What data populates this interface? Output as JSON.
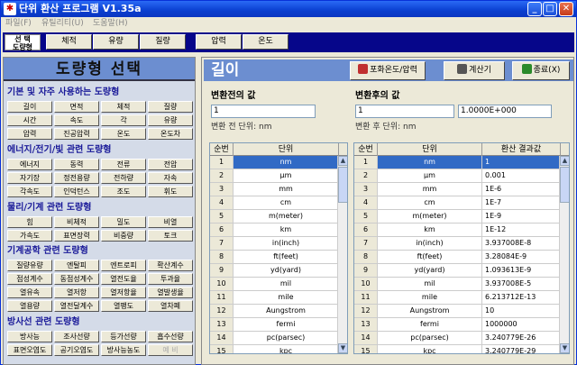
{
  "window": {
    "title": "단위 환산 프로그램 V1.35a"
  },
  "menu": [
    "파일(F)",
    "유틸리티(U)",
    "도움말(H)"
  ],
  "toolbar": {
    "select_tag_line1": "선 택",
    "select_tag_line2": "도량형",
    "quick": [
      "체적",
      "유량",
      "질량",
      "압력",
      "온도"
    ]
  },
  "left": {
    "title": "도량형 선택",
    "groups": [
      {
        "title": "기본 및 자주 사용하는 도량형",
        "items": [
          "길이",
          "면적",
          "체적",
          "질량",
          "시간",
          "속도",
          "각",
          "유량",
          "압력",
          "진공압력",
          "온도",
          "온도차"
        ]
      },
      {
        "title": "에너지/전기/빛 관련 도량형",
        "items": [
          "에너지",
          "동력",
          "전류",
          "전압",
          "자기장",
          "정전용량",
          "전하량",
          "자속",
          "각속도",
          "인덕턴스",
          "조도",
          "휘도"
        ]
      },
      {
        "title": "물리/기계 관련 도량형",
        "items": [
          "힘",
          "비체적",
          "밀도",
          "비열",
          "가속도",
          "표면장력",
          "비중량",
          "토크"
        ]
      },
      {
        "title": "기계공학 관련 도량형",
        "items": [
          "질량유량",
          "엔탈피",
          "엔트로피",
          "확산계수",
          "점성계수",
          "동점성계수",
          "열전도율",
          "투과율",
          "열유속",
          "열저항",
          "열저항율",
          "열발생율",
          "열용량",
          "열전달계수",
          "열팽도",
          "열차폐"
        ]
      },
      {
        "title": "방사선 관련 도량형",
        "items": [
          "방사능",
          "조사선량",
          "등가선량",
          "흡수선량",
          "표면오염도",
          "공기오염도",
          "방사능농도",
          "예 비"
        ]
      }
    ]
  },
  "right": {
    "category_title": "길이",
    "buttons": {
      "temp_pressure": "포화온도/압력",
      "calculator": "계산기",
      "exit": "종료(X)"
    },
    "before": {
      "label": "변환전의 값",
      "value": "1",
      "unit_label": "변환 전 단위: nm"
    },
    "after": {
      "label": "변환후의 값",
      "value": "1",
      "result": "1.0000E+000",
      "unit_label": "변환 후 단위: nm"
    },
    "left_list": {
      "headers": [
        "순번",
        "단위"
      ],
      "rows": [
        [
          "1",
          "nm"
        ],
        [
          "2",
          "μm"
        ],
        [
          "3",
          "mm"
        ],
        [
          "4",
          "cm"
        ],
        [
          "5",
          "m(meter)"
        ],
        [
          "6",
          "km"
        ],
        [
          "7",
          "in(inch)"
        ],
        [
          "8",
          "ft(feet)"
        ],
        [
          "9",
          "yd(yard)"
        ],
        [
          "10",
          "mil"
        ],
        [
          "11",
          "mile"
        ],
        [
          "12",
          "Aungstrom"
        ],
        [
          "13",
          "fermi"
        ],
        [
          "14",
          "pc(parsec)"
        ],
        [
          "15",
          "kpc"
        ]
      ]
    },
    "right_list": {
      "headers": [
        "순번",
        "단위",
        "환산 결과값"
      ],
      "rows": [
        [
          "1",
          "nm",
          "1"
        ],
        [
          "2",
          "μm",
          "0.001"
        ],
        [
          "3",
          "mm",
          "1E-6"
        ],
        [
          "4",
          "cm",
          "1E-7"
        ],
        [
          "5",
          "m(meter)",
          "1E-9"
        ],
        [
          "6",
          "km",
          "1E-12"
        ],
        [
          "7",
          "in(inch)",
          "3.937008E-8"
        ],
        [
          "8",
          "ft(feet)",
          "3.28084E-9"
        ],
        [
          "9",
          "yd(yard)",
          "1.093613E-9"
        ],
        [
          "10",
          "mil",
          "3.937008E-5"
        ],
        [
          "11",
          "mile",
          "6.213712E-13"
        ],
        [
          "12",
          "Aungstrom",
          "10"
        ],
        [
          "13",
          "fermi",
          "1000000"
        ],
        [
          "14",
          "pc(parsec)",
          "3.240779E-26"
        ],
        [
          "15",
          "kpc",
          "3.240779E-29"
        ]
      ]
    }
  },
  "colors": {
    "titlebar": "#0a3fd0",
    "panel_header": "#6c8ed0",
    "group_title": "#1a1a99",
    "selection": "#316ac5"
  }
}
